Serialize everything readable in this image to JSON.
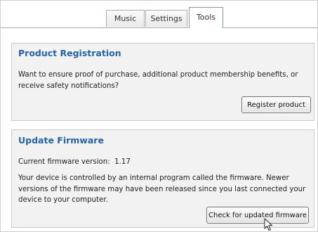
{
  "tabs": [
    {
      "label": "Music"
    },
    {
      "label": "Settings"
    },
    {
      "label": "Tools",
      "active": true
    }
  ],
  "product_registration": {
    "title": "Product Registration",
    "description": "Want to ensure proof of purchase, additional product membership benefits, or receive safety notifications?",
    "button_label": "Register product"
  },
  "update_firmware": {
    "title": "Update Firmware",
    "version_label": "Current firmware version:",
    "version_value": "1.17",
    "description": "Your device is controlled by an internal program called the firmware. Newer versions of the firmware may have been released since you last connected your device to your computer.",
    "button_label": "Check for updated firmware"
  },
  "colors": {
    "title_blue": "#2563a8",
    "panel_bg": "#f2f2f2"
  },
  "icons": {
    "cursor": "mouse-pointer-icon"
  }
}
